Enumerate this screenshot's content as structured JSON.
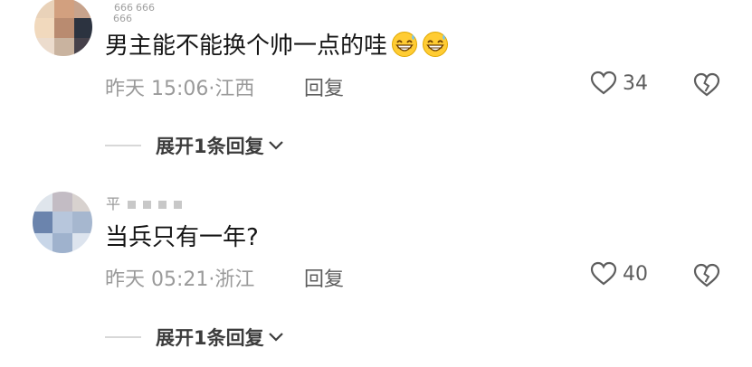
{
  "comments": [
    {
      "username": "",
      "username_marks": [
        "666",
        "666",
        "666"
      ],
      "text": "男主能不能换个帅一点的哇",
      "emojis": [
        "grinning-sweat-emoji",
        "grinning-sweat-emoji"
      ],
      "time": "昨天 15:06",
      "location": "江西",
      "reply_label": "回复",
      "likes": "34",
      "expand_label": "展开1条回复"
    },
    {
      "username": "平",
      "text": "当兵只有一年?",
      "time": "昨天 05:21",
      "location": "浙江",
      "reply_label": "回复",
      "likes": "40",
      "expand_label": "展开1条回复"
    }
  ],
  "colors": {
    "text": "#161616",
    "meta": "#9a9a9a",
    "action": "#5e5e5e",
    "divider": "#d8d8d8"
  }
}
